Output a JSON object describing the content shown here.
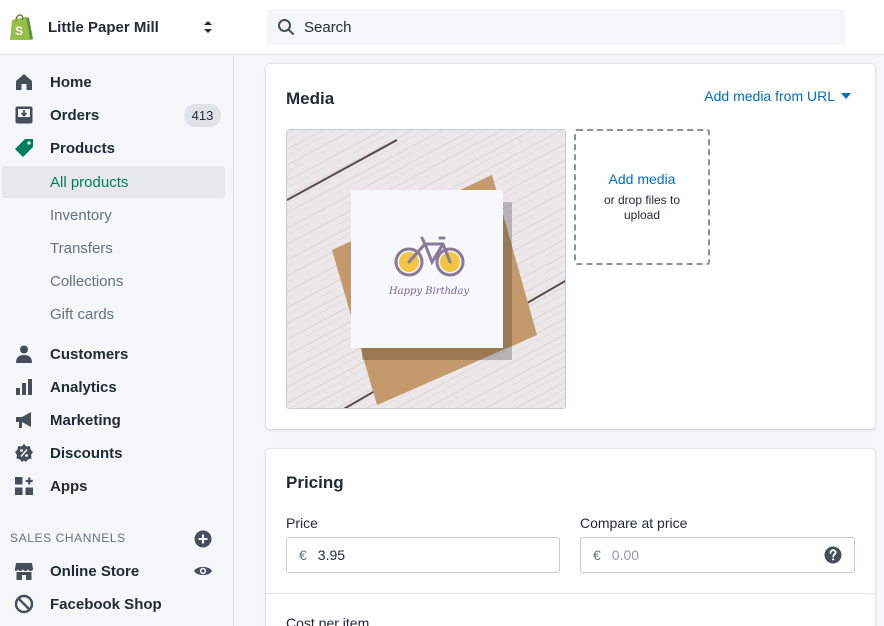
{
  "header": {
    "store_name": "Little Paper Mill",
    "search_placeholder": "Search"
  },
  "sidebar": {
    "items": [
      {
        "label": "Home",
        "icon": "home-icon"
      },
      {
        "label": "Orders",
        "icon": "orders-icon",
        "badge": "413"
      },
      {
        "label": "Products",
        "icon": "tag-icon"
      },
      {
        "label": "Customers",
        "icon": "person-icon"
      },
      {
        "label": "Analytics",
        "icon": "bar-chart-icon"
      },
      {
        "label": "Marketing",
        "icon": "megaphone-icon"
      },
      {
        "label": "Discounts",
        "icon": "discount-icon"
      },
      {
        "label": "Apps",
        "icon": "apps-icon"
      }
    ],
    "product_subitems": [
      "All products",
      "Inventory",
      "Transfers",
      "Collections",
      "Gift cards"
    ],
    "active_subitem": "All products",
    "sales_channels_label": "SALES CHANNELS",
    "channels": [
      {
        "label": "Online Store",
        "icon": "store-icon"
      },
      {
        "label": "Facebook Shop",
        "icon": "blocked-icon"
      }
    ]
  },
  "media": {
    "title": "Media",
    "add_from_url": "Add media from URL",
    "add_media": "Add media",
    "drop_hint": "or drop files to upload",
    "image_caption": "Happy Birthday"
  },
  "pricing": {
    "title": "Pricing",
    "price_label": "Price",
    "price_currency": "€",
    "price_value": "3.95",
    "compare_label": "Compare at price",
    "compare_currency": "€",
    "compare_placeholder": "0.00",
    "cost_label": "Cost per item"
  },
  "colors": {
    "accent_green": "#007f5f",
    "link_blue": "#006fbb",
    "shopify_green": "#95bf47"
  }
}
